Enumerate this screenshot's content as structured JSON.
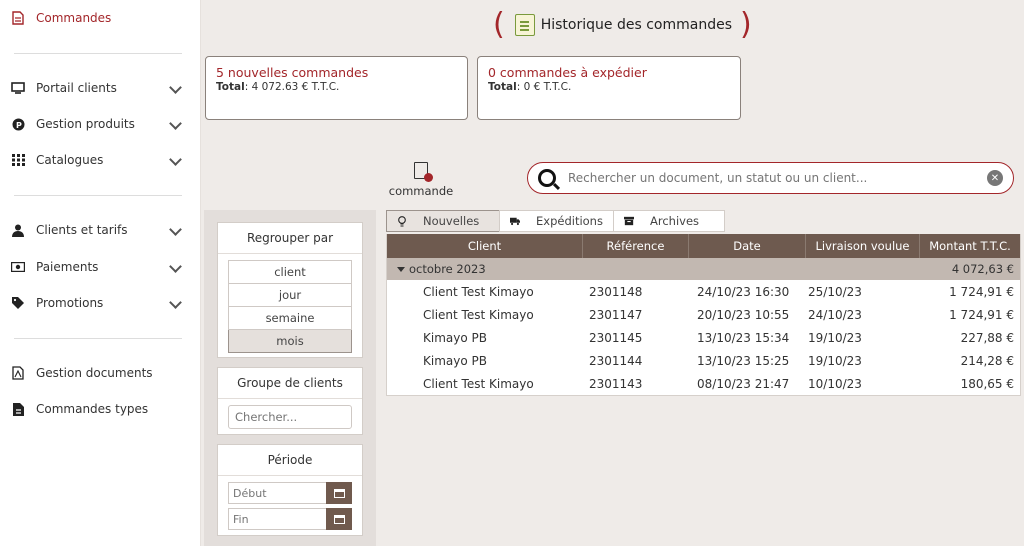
{
  "sidebar": {
    "items": [
      {
        "label": "Commandes",
        "icon": "file-icon",
        "active": true,
        "chevron": false
      },
      {
        "label": "Portail clients",
        "icon": "monitor-icon",
        "chevron": true
      },
      {
        "label": "Gestion produits",
        "icon": "p-circle-icon",
        "chevron": true
      },
      {
        "label": "Catalogues",
        "icon": "grid-icon",
        "chevron": true
      },
      {
        "label": "Clients et tarifs",
        "icon": "user-icon",
        "chevron": true
      },
      {
        "label": "Paiements",
        "icon": "banknote-icon",
        "chevron": true
      },
      {
        "label": "Promotions",
        "icon": "tag-icon",
        "chevron": true
      },
      {
        "label": "Gestion documents",
        "icon": "pdf-file-icon",
        "chevron": false
      },
      {
        "label": "Commandes types",
        "icon": "file-template-icon",
        "chevron": false
      }
    ]
  },
  "header": {
    "title": "Historique des commandes"
  },
  "stats": [
    {
      "heading": "5 nouvelles commandes",
      "total_label": "Total",
      "total_value": ": 4 072.63 € T.T.C."
    },
    {
      "heading": "0 commandes à expédier",
      "total_label": "Total",
      "total_value": ": 0 € T.T.C."
    }
  ],
  "new_order": {
    "label": "commande"
  },
  "search": {
    "placeholder": "Rechercher un document, un statut ou un client..."
  },
  "filters": {
    "group_title": "Regrouper par",
    "group_options": [
      "client",
      "jour",
      "semaine",
      "mois"
    ],
    "group_selected": "mois",
    "client_group_title": "Groupe de clients",
    "client_group_placeholder": "Chercher...",
    "period_title": "Période",
    "start_placeholder": "Début",
    "end_placeholder": "Fin"
  },
  "tabs": [
    {
      "label": "Nouvelles",
      "icon": "lightbulb-icon",
      "selected": true
    },
    {
      "label": "Expéditions",
      "icon": "truck-icon",
      "selected": false
    },
    {
      "label": "Archives",
      "icon": "archive-icon",
      "selected": false
    }
  ],
  "table": {
    "columns": [
      "Client",
      "Référence",
      "Date",
      "Livraison voulue",
      "Montant T.T.C."
    ],
    "group": {
      "label": "octobre 2023",
      "amount": "4 072,63 €"
    },
    "rows": [
      [
        "Client Test Kimayo",
        "2301148",
        "24/10/23 16:30",
        "25/10/23",
        "1 724,91 €"
      ],
      [
        "Client Test Kimayo",
        "2301147",
        "20/10/23 10:55",
        "24/10/23",
        "1 724,91 €"
      ],
      [
        "Kimayo PB",
        "2301145",
        "13/10/23 15:34",
        "19/10/23",
        "227,88 €"
      ],
      [
        "Kimayo PB",
        "2301144",
        "13/10/23 15:25",
        "19/10/23",
        "214,28 €"
      ],
      [
        "Client Test Kimayo",
        "2301143",
        "08/10/23 21:47",
        "10/10/23",
        "180,65 €"
      ]
    ]
  },
  "colors": {
    "accent": "#a3262a",
    "table_header": "#6e5a4f",
    "group_row": "#c2b8b1"
  }
}
